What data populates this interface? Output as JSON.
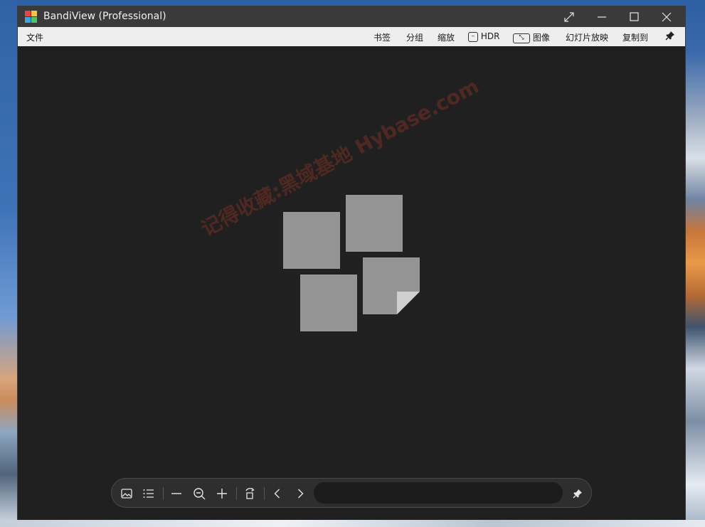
{
  "window": {
    "title": "BandiView (Professional)",
    "controls": {
      "fullscreen_icon": "expand-diagonal-icon",
      "minimize_icon": "minimize-icon",
      "maximize_icon": "maximize-icon",
      "close_icon": "close-icon"
    }
  },
  "menubar": {
    "file": "文件",
    "bookmark": "书签",
    "group": "分组",
    "zoom": "缩放",
    "hdr": "HDR",
    "image": "图像",
    "slideshow": "幻灯片放映",
    "copy_to": "复制到",
    "pin_icon": "pin-icon"
  },
  "canvas": {
    "placeholder_icon": "empty-images-icon",
    "watermark": "记得收藏:黑域基地 Hybase.com"
  },
  "toolbar": {
    "buttons": [
      "image-icon",
      "list-icon",
      "zoom-out-minus-icon",
      "zoom-fit-icon",
      "zoom-in-plus-icon",
      "rotate-icon",
      "prev-icon",
      "next-icon",
      "pin-icon"
    ],
    "search_value": ""
  },
  "colors": {
    "titlebar_bg": "#3a3a3a",
    "menubar_bg": "#eeeeee",
    "canvas_bg": "#202020",
    "placeholder_tile": "#959595"
  }
}
